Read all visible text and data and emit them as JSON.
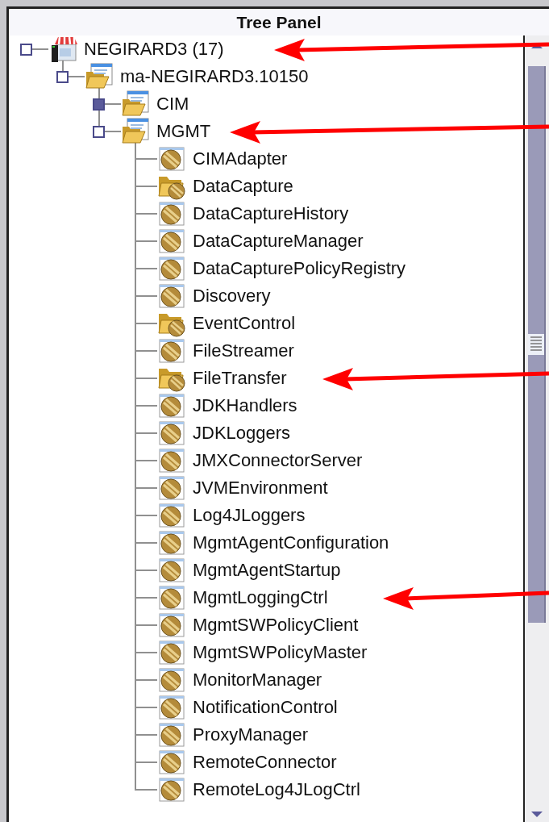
{
  "panel": {
    "title": "Tree Panel"
  },
  "tree": [
    {
      "label": "NEGIRARD3 (17)",
      "kind": "server",
      "expanded": true,
      "children": [
        {
          "label": "ma-NEGIRARD3.10150",
          "kind": "folder",
          "expanded": true,
          "children": [
            {
              "label": "CIM",
              "kind": "folder",
              "expanded": false
            },
            {
              "label": "MGMT",
              "kind": "folder",
              "expanded": true,
              "children": [
                {
                  "label": "CIMAdapter",
                  "kind": "bean"
                },
                {
                  "label": "DataCapture",
                  "kind": "bean-folder"
                },
                {
                  "label": "DataCaptureHistory",
                  "kind": "bean"
                },
                {
                  "label": "DataCaptureManager",
                  "kind": "bean"
                },
                {
                  "label": "DataCapturePolicyRegistry",
                  "kind": "bean"
                },
                {
                  "label": "Discovery",
                  "kind": "bean"
                },
                {
                  "label": "EventControl",
                  "kind": "bean-folder"
                },
                {
                  "label": "FileStreamer",
                  "kind": "bean"
                },
                {
                  "label": "FileTransfer",
                  "kind": "bean-folder"
                },
                {
                  "label": "JDKHandlers",
                  "kind": "bean"
                },
                {
                  "label": "JDKLoggers",
                  "kind": "bean"
                },
                {
                  "label": "JMXConnectorServer",
                  "kind": "bean"
                },
                {
                  "label": "JVMEnvironment",
                  "kind": "bean"
                },
                {
                  "label": "Log4JLoggers",
                  "kind": "bean"
                },
                {
                  "label": "MgmtAgentConfiguration",
                  "kind": "bean"
                },
                {
                  "label": "MgmtAgentStartup",
                  "kind": "bean"
                },
                {
                  "label": "MgmtLoggingCtrl",
                  "kind": "bean"
                },
                {
                  "label": "MgmtSWPolicyClient",
                  "kind": "bean"
                },
                {
                  "label": "MgmtSWPolicyMaster",
                  "kind": "bean"
                },
                {
                  "label": "MonitorManager",
                  "kind": "bean"
                },
                {
                  "label": "NotificationControl",
                  "kind": "bean"
                },
                {
                  "label": "ProxyManager",
                  "kind": "bean"
                },
                {
                  "label": "RemoteConnector",
                  "kind": "bean"
                },
                {
                  "label": "RemoteLog4JLogCtrl",
                  "kind": "bean"
                }
              ]
            }
          ]
        }
      ]
    }
  ]
}
